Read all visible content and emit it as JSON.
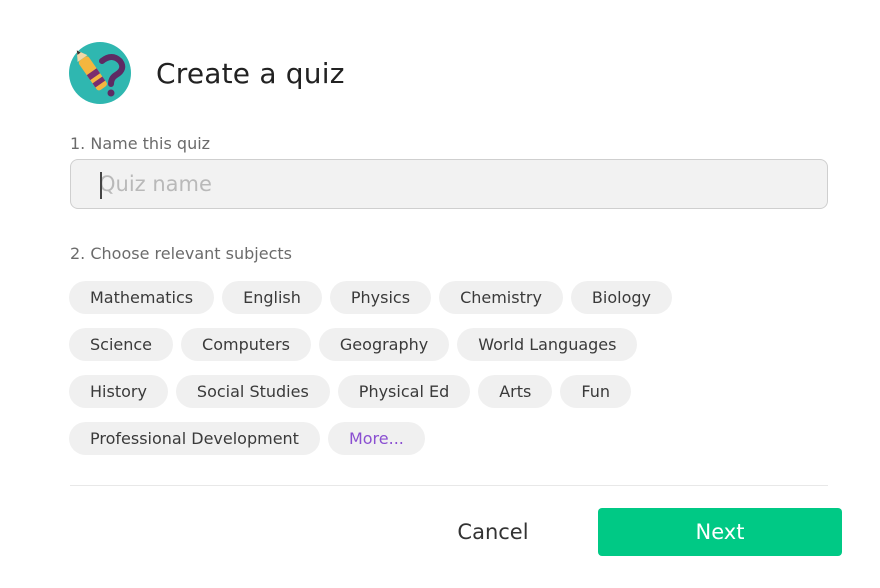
{
  "dialog": {
    "title": "Create a quiz",
    "logo_icon": "quiz-pencil-question-icon"
  },
  "name_section": {
    "label": "1. Name this quiz",
    "input_placeholder": "Quiz name",
    "input_value": ""
  },
  "subjects_section": {
    "label": "2. Choose relevant subjects",
    "rows": [
      [
        "Mathematics",
        "English",
        "Physics",
        "Chemistry",
        "Biology"
      ],
      [
        "Science",
        "Computers",
        "Geography",
        "World Languages"
      ],
      [
        "History",
        "Social Studies",
        "Physical Ed",
        "Arts",
        "Fun"
      ],
      [
        "Professional Development",
        "More..."
      ]
    ]
  },
  "footer": {
    "cancel_label": "Cancel",
    "next_label": "Next"
  },
  "colors": {
    "primary": "#00c985",
    "more_link": "#8a4fd1",
    "chip_bg": "#f0f0f0",
    "logo_circle": "#2fb7b0"
  }
}
